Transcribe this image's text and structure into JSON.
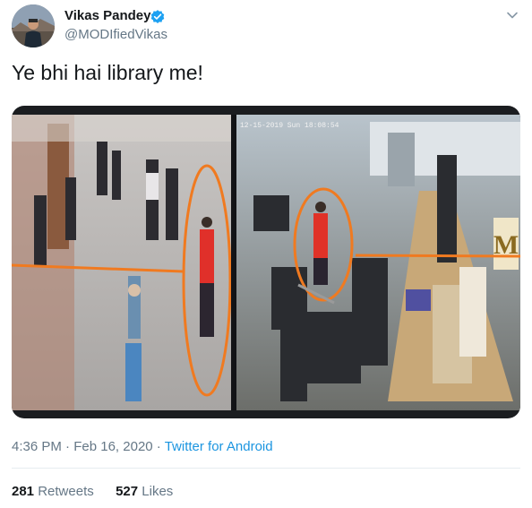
{
  "tweet": {
    "display_name": "Vikas Pandey",
    "handle": "@MODIfiedVikas",
    "text": "Ye bhi hai library me!",
    "time": "4:36 PM",
    "separator1": "·",
    "date": "Feb 16, 2020",
    "separator2": "·",
    "source": "Twitter for Android",
    "retweets_count": "281",
    "retweets_label": "Retweets",
    "likes_count": "527",
    "likes_label": "Likes"
  },
  "media": {
    "cctv_timestamp": "12-15-2019 Sun 18:08:54",
    "watermark_letter": "M",
    "annotation_color": "#f07a20"
  },
  "icons": {
    "verified": "verified-badge-icon",
    "caret": "chevron-down-icon"
  },
  "colors": {
    "link": "#1b95e0",
    "secondary_text": "#657786",
    "verified": "#1da1f2"
  }
}
